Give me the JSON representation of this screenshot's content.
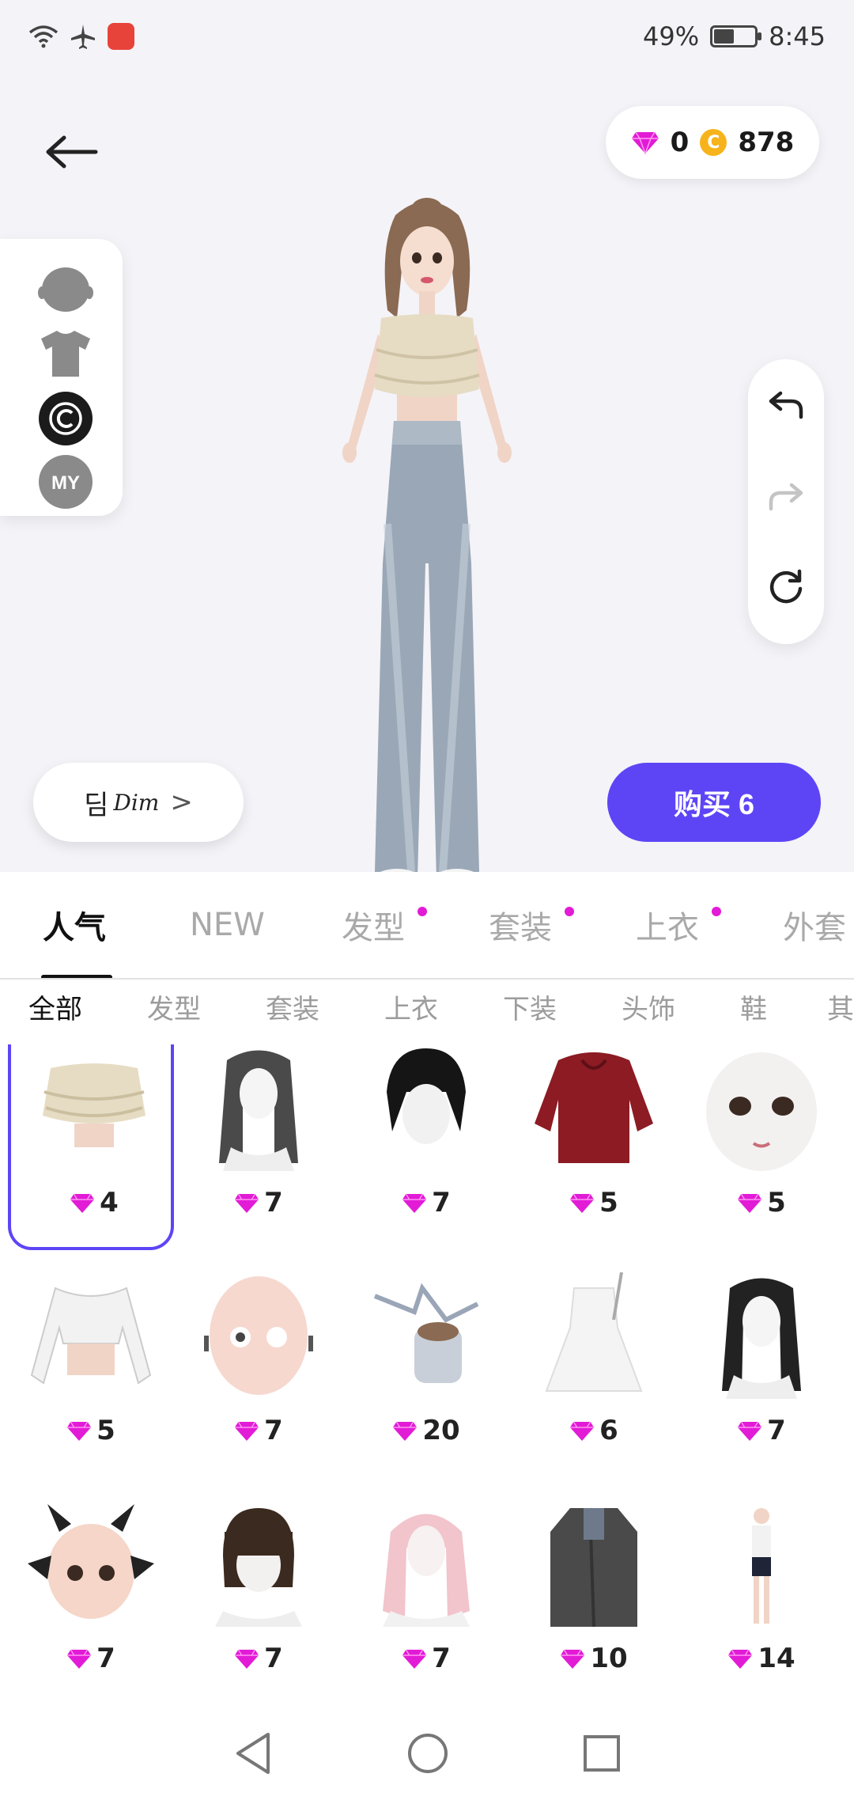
{
  "status_bar": {
    "battery": "49%",
    "battery_level": 0.49,
    "time": "8:45",
    "icons": [
      "wifi-icon",
      "airplane-icon",
      "app-badge-icon",
      "battery-icon"
    ]
  },
  "header": {
    "diamond_count": "0",
    "coin_count": "878",
    "coin_symbol": "C"
  },
  "left_tools": [
    {
      "name": "head-icon"
    },
    {
      "name": "tshirt-icon"
    },
    {
      "name": "copyright-icon",
      "glyph": "©"
    },
    {
      "name": "my-icon",
      "label": "MY"
    }
  ],
  "right_tools": [
    "undo-icon",
    "redo-icon",
    "reset-icon"
  ],
  "name_tag": {
    "prefix": "딤",
    "script": "Dim",
    "chevron": ">"
  },
  "buy_button": {
    "label": "购买 6"
  },
  "main_tabs": [
    {
      "label": "人气",
      "active": true,
      "dot": false
    },
    {
      "label": "NEW",
      "active": false,
      "dot": false
    },
    {
      "label": "发型",
      "active": false,
      "dot": true
    },
    {
      "label": "套装",
      "active": false,
      "dot": true
    },
    {
      "label": "上衣",
      "active": false,
      "dot": true
    },
    {
      "label": "外套",
      "active": false,
      "dot": false
    }
  ],
  "sub_tabs": [
    {
      "label": "全部",
      "active": true
    },
    {
      "label": "发型",
      "active": false
    },
    {
      "label": "套装",
      "active": false
    },
    {
      "label": "上衣",
      "active": false
    },
    {
      "label": "下装",
      "active": false
    },
    {
      "label": "头饰",
      "active": false
    },
    {
      "label": "鞋",
      "active": false
    },
    {
      "label": "其",
      "active": false
    }
  ],
  "items": [
    {
      "price": "4",
      "kind": "ruffle-top",
      "selected": true
    },
    {
      "price": "7",
      "kind": "long-hair-grey",
      "selected": false
    },
    {
      "price": "7",
      "kind": "short-hair-black",
      "selected": false
    },
    {
      "price": "5",
      "kind": "red-hoodie",
      "selected": false
    },
    {
      "price": "5",
      "kind": "doll-face",
      "selected": false
    },
    {
      "price": "5",
      "kind": "white-crop-top",
      "selected": false
    },
    {
      "price": "7",
      "kind": "pierced-face",
      "selected": false
    },
    {
      "price": "20",
      "kind": "crystal-headpiece",
      "selected": false
    },
    {
      "price": "6",
      "kind": "white-dress",
      "selected": false
    },
    {
      "price": "7",
      "kind": "long-hair-black",
      "selected": false
    },
    {
      "price": "7",
      "kind": "devil-horns-face",
      "selected": false
    },
    {
      "price": "7",
      "kind": "bob-hair-brown",
      "selected": false
    },
    {
      "price": "7",
      "kind": "pink-hair",
      "selected": false
    },
    {
      "price": "10",
      "kind": "long-coat",
      "selected": false
    },
    {
      "price": "14",
      "kind": "tee-shorts-outfit",
      "selected": false
    }
  ],
  "colors": {
    "accent": "#5d45f6",
    "diamond": "#e21bd6",
    "coin": "#f6b31b",
    "badge_dot": "#e21bd6"
  }
}
